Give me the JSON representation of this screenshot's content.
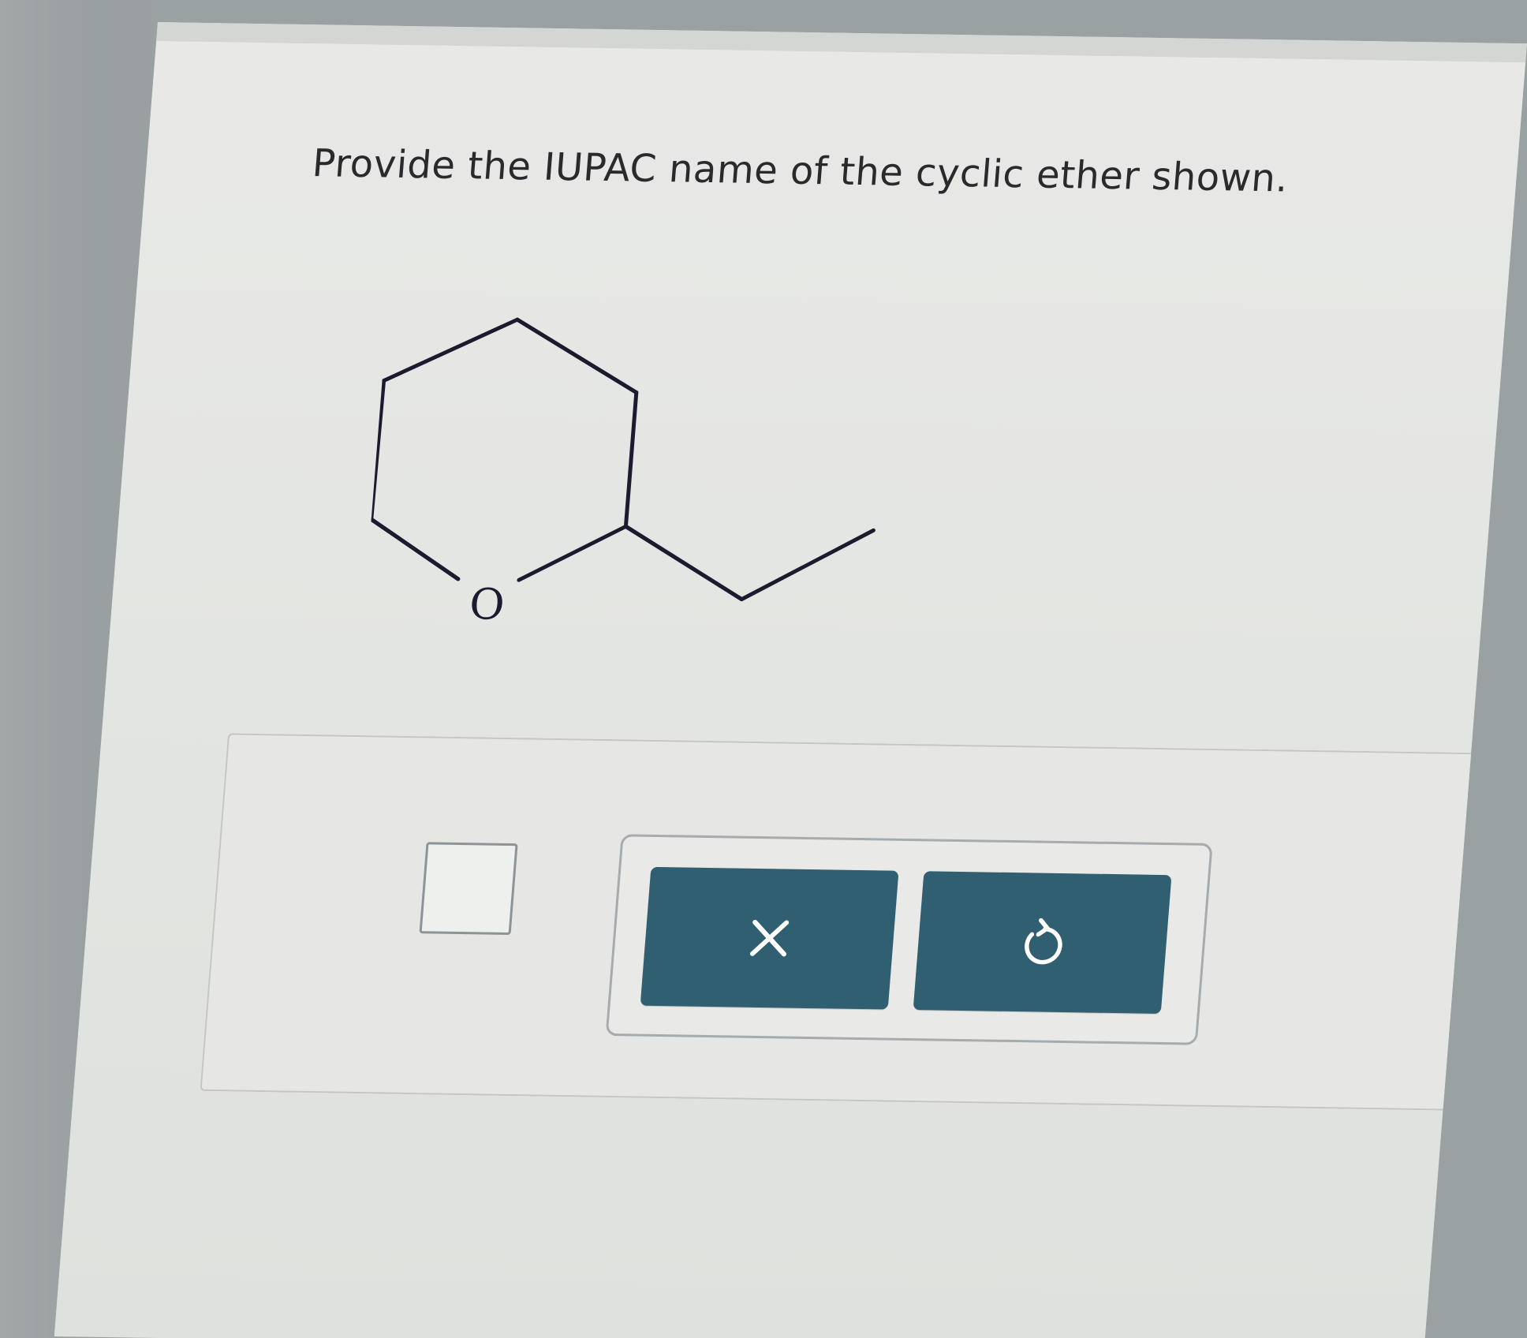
{
  "question": {
    "text": "Provide the IUPAC name of the cyclic ether shown."
  },
  "molecule": {
    "atom_label": "O"
  },
  "answer": {
    "value": ""
  },
  "toolbar": {
    "clear_icon": "x-icon",
    "undo_icon": "undo-icon",
    "button_color": "#2f5f70"
  }
}
